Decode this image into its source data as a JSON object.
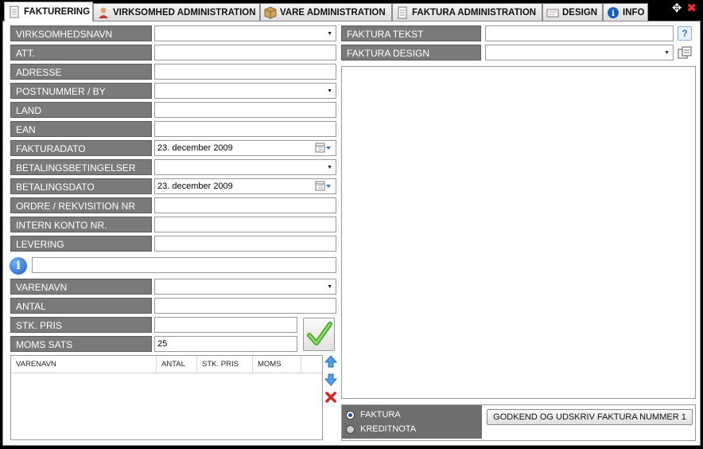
{
  "tabs": [
    {
      "label": "FAKTURERING",
      "icon": "document-icon",
      "active": true
    },
    {
      "label": "VIRKSOMHED ADMINISTRATION",
      "icon": "person-icon",
      "active": false
    },
    {
      "label": "VARE ADMINISTRATION",
      "icon": "box-icon",
      "active": false
    },
    {
      "label": "FAKTURA ADMINISTRATION",
      "icon": "document-icon",
      "active": false
    },
    {
      "label": "DESIGN",
      "icon": "design-icon",
      "active": false
    },
    {
      "label": "INFO",
      "icon": "info-icon",
      "active": false
    }
  ],
  "window": {
    "move_icon": "✥",
    "close_icon": "✖"
  },
  "form": {
    "company_label": "VIRKSOMHEDSNAVN",
    "company_value": "",
    "att_label": "ATT.",
    "att_value": "",
    "address_label": "ADRESSE",
    "address_value": "",
    "postal_label": "POSTNUMMER / BY",
    "postal_value": "",
    "country_label": "LAND",
    "country_value": "",
    "ean_label": "EAN",
    "ean_value": "",
    "invoice_date_label": "FAKTURADATO",
    "invoice_date_value": "23.  december  2009",
    "payment_terms_label": "BETALINGSBETINGELSER",
    "payment_terms_value": "",
    "payment_date_label": "BETALINGSDATO",
    "payment_date_value": "23.  december  2009",
    "order_label": "ORDRE / REKVISITION NR",
    "order_value": "",
    "account_label": "INTERN KONTO NR.",
    "account_value": "",
    "delivery_label": "LEVERING",
    "delivery_value": "",
    "info_glyph": "i",
    "info_value": ""
  },
  "item": {
    "name_label": "VARENAVN",
    "name_value": "",
    "qty_label": "ANTAL",
    "qty_value": "",
    "price_label": "STK. PRIS",
    "price_value": "",
    "vat_label": "MOMS SATS",
    "vat_value": "25"
  },
  "lines_table": {
    "columns": [
      "VARENAVN",
      "ANTAL",
      "STK. PRIS",
      "MOMS"
    ],
    "rows": []
  },
  "right": {
    "text_label": "FAKTURA TEKST",
    "text_value": "",
    "help_label": "?",
    "design_label": "FAKTURA DESIGN",
    "design_value": ""
  },
  "bottom": {
    "radio_invoice": "FAKTURA",
    "radio_credit": "KREDITNOTA",
    "print_button": "GODKEND OG UDSKRIV FAKTURA NUMMER 1"
  },
  "colors": {
    "label_bg": "#7a7a7a",
    "accent_blue": "#1a5fc2",
    "ok_green": "#4caf2a",
    "delete_red": "#e02020"
  }
}
